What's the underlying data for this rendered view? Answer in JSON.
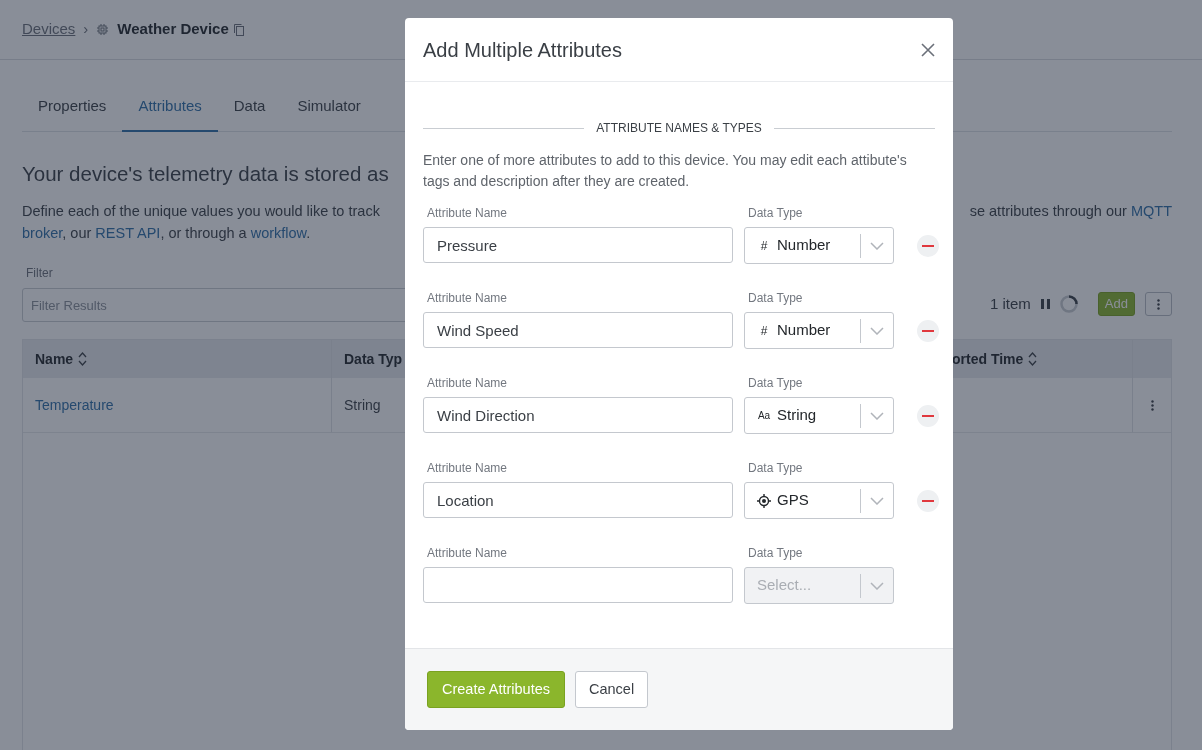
{
  "breadcrumb": {
    "parent": "Devices",
    "separator": "›",
    "current": "Weather Device"
  },
  "tabs": [
    {
      "label": "Properties",
      "selected": false
    },
    {
      "label": "Attributes",
      "selected": true
    },
    {
      "label": "Data",
      "selected": false
    },
    {
      "label": "Simulator",
      "selected": false
    }
  ],
  "heading": "Your device's telemetry data is stored as",
  "description": {
    "line1_left": [
      {
        "kind": "text",
        "text": "Define each of the unique values you would like to track"
      }
    ],
    "line1_right": [
      {
        "kind": "text",
        "text": "se attributes through our "
      },
      {
        "kind": "link",
        "text": "MQTT"
      }
    ],
    "line2": [
      {
        "kind": "link",
        "text": "broker"
      },
      {
        "kind": "text",
        "text": ", our "
      },
      {
        "kind": "link",
        "text": "REST API"
      },
      {
        "kind": "text",
        "text": ", or through a "
      },
      {
        "kind": "link",
        "text": "workflow"
      },
      {
        "kind": "text",
        "text": "."
      }
    ]
  },
  "filter": {
    "label": "Filter",
    "placeholder": "Filter Results"
  },
  "toolbar": {
    "count": "1 item",
    "add_label": "Add"
  },
  "table": {
    "columns": [
      {
        "label": "Name",
        "sortable": true
      },
      {
        "label": "Data Typ"
      },
      {
        "label": "orted Time",
        "sortable": true
      }
    ],
    "rows": [
      {
        "name": "Temperature",
        "data_type": "String"
      }
    ]
  },
  "modal": {
    "title": "Add Multiple Attributes",
    "section_title": "ATTRIBUTE NAMES & TYPES",
    "help": "Enter one of more attributes to add to this device. You may edit each attibute's tags and description after they are created.",
    "rows": [
      {
        "name_label": "Attribute Name",
        "value": "Pressure",
        "type_label": "Data Type",
        "data_type": {
          "kind": "number",
          "icon": "#",
          "value": "Number"
        },
        "disabled": false,
        "removable": true
      },
      {
        "name_label": "Attribute Name",
        "value": "Wind Speed",
        "type_label": "Data Type",
        "data_type": {
          "kind": "number",
          "icon": "#",
          "value": "Number"
        },
        "disabled": false,
        "removable": true
      },
      {
        "name_label": "Attribute Name",
        "value": "Wind Direction",
        "type_label": "Data Type",
        "data_type": {
          "kind": "string",
          "icon": "Aa",
          "value": "String"
        },
        "disabled": false,
        "removable": true
      },
      {
        "name_label": "Attribute Name",
        "value": "Location",
        "type_label": "Data Type",
        "data_type": {
          "kind": "gps",
          "value": "GPS"
        },
        "disabled": false,
        "removable": true
      },
      {
        "name_label": "Attribute Name",
        "type_label": "Data Type",
        "data_type": {
          "kind": "none",
          "placeholder": "Select..."
        },
        "disabled": true,
        "removable": false
      }
    ],
    "primary_button": "Create Attributes",
    "cancel_button": "Cancel"
  }
}
